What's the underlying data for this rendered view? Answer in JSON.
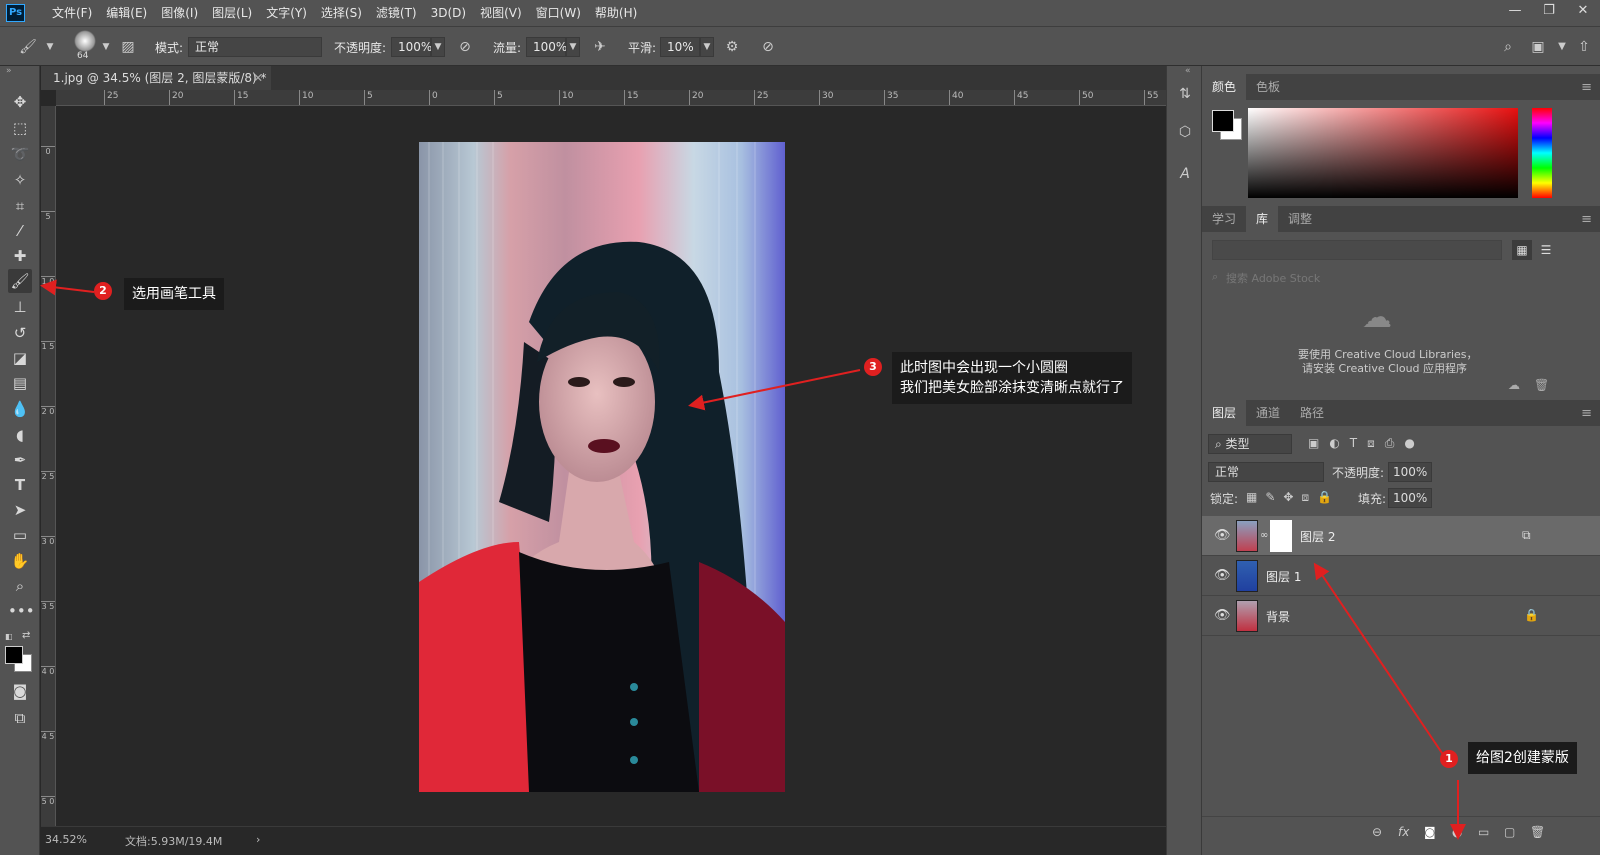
{
  "app": {
    "logo": "Ps",
    "menu": [
      "文件(F)",
      "编辑(E)",
      "图像(I)",
      "图层(L)",
      "文字(Y)",
      "选择(S)",
      "滤镜(T)",
      "3D(D)",
      "视图(V)",
      "窗口(W)",
      "帮助(H)"
    ],
    "window_buttons": [
      "—",
      "❐",
      "✕"
    ]
  },
  "options": {
    "brush_size": "64",
    "mode_label": "模式:",
    "mode_value": "正常",
    "opacity_label": "不透明度:",
    "opacity_value": "100%",
    "flow_label": "流量:",
    "flow_value": "100%",
    "smooth_label": "平滑:",
    "smooth_value": "10%"
  },
  "document": {
    "tab_title": "1.jpg @ 34.5% (图层 2, 图层蒙版/8) *",
    "ruler_h": [
      "25",
      "20",
      "15",
      "10",
      "5",
      "0",
      "5",
      "10",
      "15",
      "20",
      "25",
      "30",
      "35",
      "40",
      "45",
      "50",
      "55"
    ],
    "ruler_v": [
      "0",
      "5",
      "1 0",
      "1 5",
      "2 0",
      "2 5",
      "3 0",
      "3 5",
      "4 0",
      "4 5",
      "5 0"
    ],
    "zoom": "34.52%",
    "doc_info": "文档:5.93M/19.4M"
  },
  "panels": {
    "color_tabs": [
      "颜色",
      "色板"
    ],
    "library_tabs": [
      "学习",
      "库",
      "调整"
    ],
    "search_placeholder": "搜索 Adobe Stock",
    "cc_text_line1": "要使用 Creative Cloud Libraries，",
    "cc_text_line2": "请安装 Creative Cloud 应用程序",
    "layers_tabs": [
      "图层",
      "通道",
      "路径"
    ],
    "filter_kind": "类型",
    "blend_mode": "正常",
    "opacity_label": "不透明度:",
    "opacity_value": "100%",
    "lock_label": "锁定:",
    "fill_label": "填充:",
    "fill_value": "100%",
    "layers": [
      {
        "name": "图层 2",
        "selected": true
      },
      {
        "name": "图层 1",
        "selected": false
      },
      {
        "name": "背景",
        "selected": false
      }
    ],
    "bottom_icons": [
      "⊖",
      "fx",
      "◙",
      "◐",
      "▭",
      "▢",
      "🗑"
    ]
  },
  "callouts": [
    {
      "num": "1",
      "text": "给图2创建蒙版"
    },
    {
      "num": "2",
      "text": "选用画笔工具"
    },
    {
      "num": "3",
      "text": "此时图中会出现一个小圆圈\n我们把美女脸部涂抹变清晰点就行了"
    }
  ],
  "colors": {
    "accent_red": "#e02020",
    "panel_bg": "#535353",
    "canvas_bg": "#282828"
  }
}
